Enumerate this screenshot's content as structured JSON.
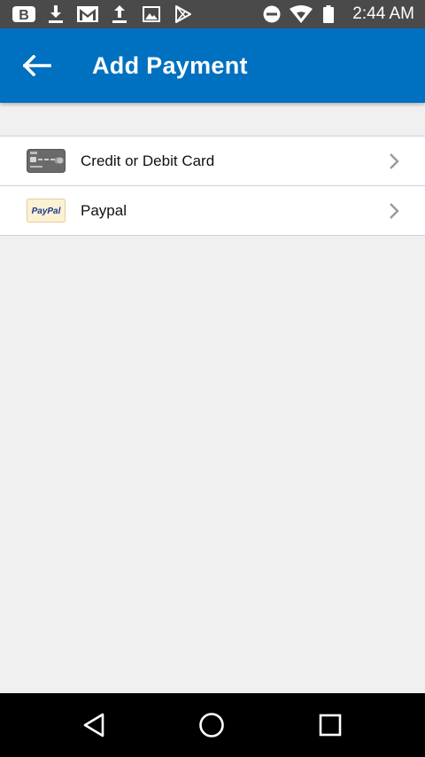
{
  "status_bar": {
    "time": "2:44 AM",
    "left_icons": [
      "b-app-icon",
      "download-icon",
      "gmail-icon",
      "upload-icon",
      "image-icon",
      "play-store-icon"
    ],
    "right_icons": [
      "do-not-disturb-icon",
      "wifi-icon",
      "battery-icon"
    ]
  },
  "app_bar": {
    "title": "Add Payment",
    "background": "#0070c0"
  },
  "payment_options": [
    {
      "label": "Credit or Debit Card",
      "icon": "credit-card-icon"
    },
    {
      "label": "Paypal",
      "icon": "paypal-icon",
      "icon_text": "PayPal"
    }
  ],
  "nav_bar": {
    "buttons": [
      "back-triangle-icon",
      "home-circle-icon",
      "recents-square-icon"
    ]
  }
}
